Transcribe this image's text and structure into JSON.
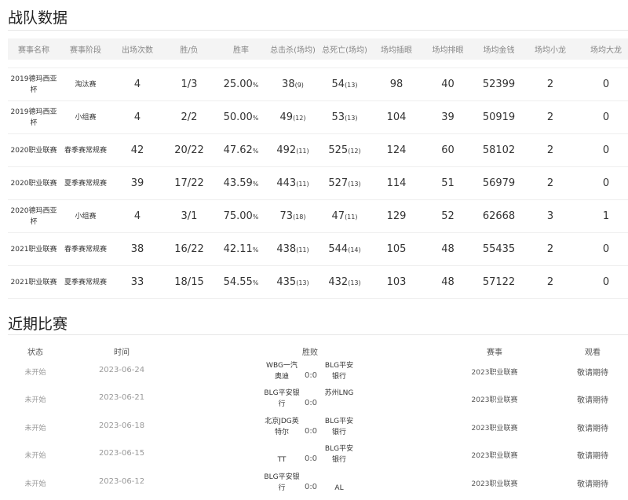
{
  "team_stats": {
    "title": "战队数据",
    "columns": [
      "赛事名称",
      "赛事阶段",
      "出场次数",
      "胜/负",
      "胜率",
      "总击杀(场均)",
      "总死亡(场均)",
      "场均插眼",
      "场均排眼",
      "场均金钱",
      "场均小龙",
      "场均大龙"
    ],
    "rows": [
      {
        "event": "2019德玛西亚杯",
        "stage": "淘汰赛",
        "played": "4",
        "wl": "1/3",
        "rate": "25.00",
        "rate_unit": "%",
        "kills": "38",
        "kills_avg": "(9)",
        "deaths": "54",
        "deaths_avg": "(13)",
        "wards": "98",
        "wards_cleared": "40",
        "gold": "52399",
        "dragons": "2",
        "barons": "0"
      },
      {
        "event": "2019德玛西亚杯",
        "stage": "小组赛",
        "played": "4",
        "wl": "2/2",
        "rate": "50.00",
        "rate_unit": "%",
        "kills": "49",
        "kills_avg": "(12)",
        "deaths": "53",
        "deaths_avg": "(13)",
        "wards": "104",
        "wards_cleared": "39",
        "gold": "50919",
        "dragons": "2",
        "barons": "0"
      },
      {
        "event": "2020职业联赛",
        "stage": "春季赛常规赛",
        "played": "42",
        "wl": "20/22",
        "rate": "47.62",
        "rate_unit": "%",
        "kills": "492",
        "kills_avg": "(11)",
        "deaths": "525",
        "deaths_avg": "(12)",
        "wards": "124",
        "wards_cleared": "60",
        "gold": "58102",
        "dragons": "2",
        "barons": "0"
      },
      {
        "event": "2020职业联赛",
        "stage": "夏季赛常规赛",
        "played": "39",
        "wl": "17/22",
        "rate": "43.59",
        "rate_unit": "%",
        "kills": "443",
        "kills_avg": "(11)",
        "deaths": "527",
        "deaths_avg": "(13)",
        "wards": "114",
        "wards_cleared": "51",
        "gold": "56979",
        "dragons": "2",
        "barons": "0"
      },
      {
        "event": "2020德玛西亚杯",
        "stage": "小组赛",
        "played": "4",
        "wl": "3/1",
        "rate": "75.00",
        "rate_unit": "%",
        "kills": "73",
        "kills_avg": "(18)",
        "deaths": "47",
        "deaths_avg": "(11)",
        "wards": "129",
        "wards_cleared": "52",
        "gold": "62668",
        "dragons": "3",
        "barons": "1"
      },
      {
        "event": "2021职业联赛",
        "stage": "春季赛常规赛",
        "played": "38",
        "wl": "16/22",
        "rate": "42.11",
        "rate_unit": "%",
        "kills": "438",
        "kills_avg": "(11)",
        "deaths": "544",
        "deaths_avg": "(14)",
        "wards": "105",
        "wards_cleared": "48",
        "gold": "55435",
        "dragons": "2",
        "barons": "0"
      },
      {
        "event": "2021职业联赛",
        "stage": "夏季赛常规赛",
        "played": "33",
        "wl": "18/15",
        "rate": "54.55",
        "rate_unit": "%",
        "kills": "435",
        "kills_avg": "(13)",
        "deaths": "432",
        "deaths_avg": "(13)",
        "wards": "103",
        "wards_cleared": "48",
        "gold": "57122",
        "dragons": "2",
        "barons": "0"
      }
    ]
  },
  "recent_matches": {
    "title": "近期比赛",
    "columns": {
      "status": "状态",
      "time": "时间",
      "result": "胜败",
      "event": "赛事",
      "watch": "观看"
    },
    "rows": [
      {
        "status": "未开始",
        "time": "2023-06-24",
        "home": "WBG一汽奥迪",
        "score": "0:0",
        "away": "BLG平安银行",
        "event": "2023职业联赛",
        "watch": "敬请期待"
      },
      {
        "status": "未开始",
        "time": "2023-06-21",
        "home": "BLG平安银行",
        "score": "0:0",
        "away": "苏州LNG",
        "event": "2023职业联赛",
        "watch": "敬请期待"
      },
      {
        "status": "未开始",
        "time": "2023-06-18",
        "home": "北京JDG英特尔",
        "score": "0:0",
        "away": "BLG平安银行",
        "event": "2023职业联赛",
        "watch": "敬请期待"
      },
      {
        "status": "未开始",
        "time": "2023-06-15",
        "home": "TT",
        "score": "0:0",
        "away": "BLG平安银行",
        "event": "2023职业联赛",
        "watch": "敬请期待"
      },
      {
        "status": "未开始",
        "time": "2023-06-12",
        "home": "BLG平安银行",
        "score": "0:0",
        "away": "AL",
        "event": "2023职业联赛",
        "watch": "敬请期待"
      }
    ]
  }
}
